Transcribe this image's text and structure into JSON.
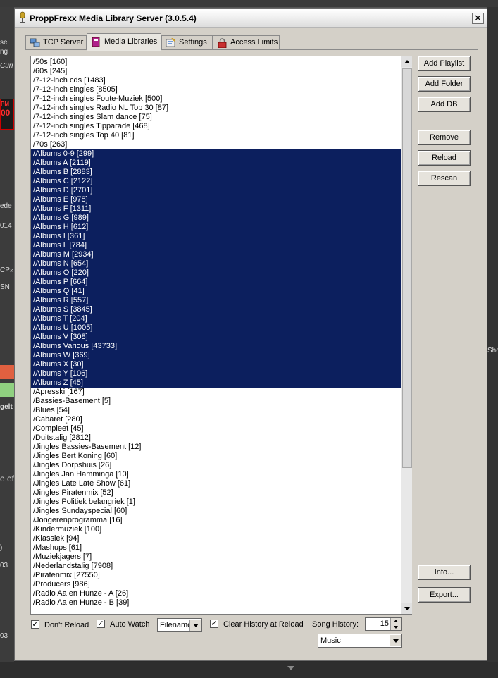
{
  "window": {
    "title": "ProppFrexx Media Library Server (3.0.5.4)",
    "close_label": "✕"
  },
  "tabs": [
    {
      "label": "TCP Server",
      "icon": "network-icon"
    },
    {
      "label": "Media Libraries",
      "icon": "library-icon",
      "active": true
    },
    {
      "label": "Settings",
      "icon": "settings-icon"
    },
    {
      "label": "Access Limits",
      "icon": "lock-icon"
    }
  ],
  "library_list": [
    {
      "text": "/50s [160]",
      "selected": false
    },
    {
      "text": "/60s [245]",
      "selected": false
    },
    {
      "text": "/7-12-inch cds [1483]",
      "selected": false
    },
    {
      "text": "/7-12-inch singles [8505]",
      "selected": false
    },
    {
      "text": "/7-12-inch singles Foute-Muziek [500]",
      "selected": false
    },
    {
      "text": "/7-12-inch singles Radio NL Top 30 [87]",
      "selected": false
    },
    {
      "text": "/7-12-inch singles Slam dance [75]",
      "selected": false
    },
    {
      "text": "/7-12-inch singles Tipparade [468]",
      "selected": false
    },
    {
      "text": "/7-12-inch singles Top 40 [81]",
      "selected": false
    },
    {
      "text": "/70s [263]",
      "selected": false
    },
    {
      "text": "/Albums 0-9 [299]",
      "selected": true
    },
    {
      "text": "/Albums A [2119]",
      "selected": true
    },
    {
      "text": "/Albums B [2883]",
      "selected": true
    },
    {
      "text": "/Albums C [2122]",
      "selected": true
    },
    {
      "text": "/Albums D [2701]",
      "selected": true
    },
    {
      "text": "/Albums E [978]",
      "selected": true
    },
    {
      "text": "/Albums F [1311]",
      "selected": true
    },
    {
      "text": "/Albums G [989]",
      "selected": true
    },
    {
      "text": "/Albums H [612]",
      "selected": true
    },
    {
      "text": "/Albums I [361]",
      "selected": true
    },
    {
      "text": "/Albums L [784]",
      "selected": true
    },
    {
      "text": "/Albums M [2934]",
      "selected": true
    },
    {
      "text": "/Albums N [654]",
      "selected": true
    },
    {
      "text": "/Albums O [220]",
      "selected": true
    },
    {
      "text": "/Albums P [664]",
      "selected": true
    },
    {
      "text": "/Albums Q [41]",
      "selected": true
    },
    {
      "text": "/Albums R [557]",
      "selected": true
    },
    {
      "text": "/Albums S [3845]",
      "selected": true
    },
    {
      "text": "/Albums T [204]",
      "selected": true
    },
    {
      "text": "/Albums U [1005]",
      "selected": true
    },
    {
      "text": "/Albums V [308]",
      "selected": true
    },
    {
      "text": "/Albums Various [43733]",
      "selected": true
    },
    {
      "text": "/Albums W [369]",
      "selected": true
    },
    {
      "text": "/Albums X [30]",
      "selected": true
    },
    {
      "text": "/Albums Y [106]",
      "selected": true
    },
    {
      "text": "/Albums Z [45]",
      "selected": true
    },
    {
      "text": "/Apresski [167]",
      "selected": false
    },
    {
      "text": "/Bassies-Basement [5]",
      "selected": false
    },
    {
      "text": "/Blues [54]",
      "selected": false
    },
    {
      "text": "/Cabaret [280]",
      "selected": false
    },
    {
      "text": "/Compleet [45]",
      "selected": false
    },
    {
      "text": "/Duitstalig [2812]",
      "selected": false
    },
    {
      "text": "/Jingles Bassies-Basement [12]",
      "selected": false
    },
    {
      "text": "/Jingles Bert Koning [60]",
      "selected": false
    },
    {
      "text": "/Jingles Dorpshuis [26]",
      "selected": false
    },
    {
      "text": "/Jingles Jan Hamminga [10]",
      "selected": false
    },
    {
      "text": "/Jingles Late Late Show [61]",
      "selected": false
    },
    {
      "text": "/Jingles Piratenmix [52]",
      "selected": false
    },
    {
      "text": "/Jingles Politiek belangriek [1]",
      "selected": false
    },
    {
      "text": "/Jingles Sundayspecial [60]",
      "selected": false
    },
    {
      "text": "/Jongerenprogramma [16]",
      "selected": false
    },
    {
      "text": "/Kindermuziek [100]",
      "selected": false
    },
    {
      "text": "/Klassiek [94]",
      "selected": false
    },
    {
      "text": "/Mashups [61]",
      "selected": false
    },
    {
      "text": "/Muziekjagers [7]",
      "selected": false
    },
    {
      "text": "/Nederlandstalig [7908]",
      "selected": false
    },
    {
      "text": "/Piratenmix [27550]",
      "selected": false
    },
    {
      "text": "/Producers [986]",
      "selected": false
    },
    {
      "text": "/Radio Aa en Hunze - A [26]",
      "selected": false
    },
    {
      "text": "/Radio Aa en Hunze - B [39]",
      "selected": false
    }
  ],
  "buttons": {
    "add_playlist": "Add Playlist",
    "add_folder": "Add Folder",
    "add_db": "Add DB",
    "remove": "Remove",
    "reload": "Reload",
    "rescan": "Rescan",
    "info": "Info...",
    "export": "Export..."
  },
  "options": {
    "dont_reload": {
      "label": "Don't Reload",
      "checked": true
    },
    "auto_watch": {
      "label": "Auto Watch",
      "checked": true
    },
    "watch_mode": {
      "value": "Filename"
    },
    "clear_history": {
      "label": "Clear History at Reload",
      "checked": true
    },
    "song_history": {
      "label": "Song History:",
      "value": "15"
    },
    "category": {
      "value": "Music"
    }
  },
  "background_fragments": {
    "f1": "se",
    "f2": "ng",
    "f3": "Curr",
    "f4": "PM",
    "f5": "00",
    "f6": "ede",
    "f7": "014",
    "f8": "CP»",
    "f9": "SN",
    "f10": "gelt",
    "f11": "e ef",
    "f12": ")",
    "f13": "03",
    "f14": "03",
    "f15": "Sho"
  },
  "colors": {
    "selection": "#0c1f5e",
    "dialog_bg": "#d4d0c8"
  }
}
